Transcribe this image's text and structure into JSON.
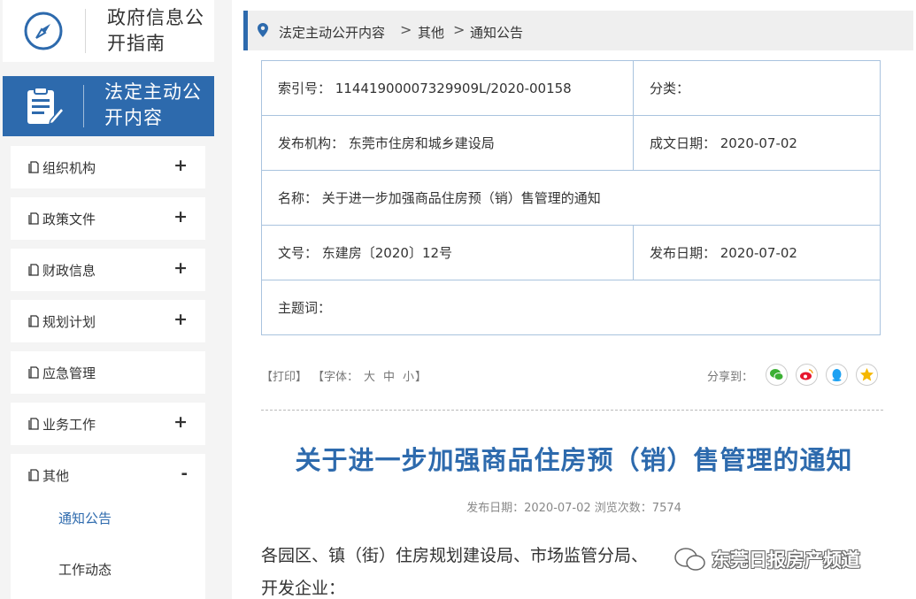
{
  "sidebar": {
    "guide_title": "政府信息公开指南",
    "active_title": "法定主动公开内容",
    "items": [
      {
        "label": "组织机构",
        "toggle": "+"
      },
      {
        "label": "政策文件",
        "toggle": "+"
      },
      {
        "label": "财政信息",
        "toggle": "+"
      },
      {
        "label": "规划计划",
        "toggle": "+"
      },
      {
        "label": "应急管理",
        "toggle": ""
      },
      {
        "label": "业务工作",
        "toggle": "+"
      }
    ],
    "open_item": {
      "label": "其他",
      "toggle": "-",
      "children": [
        "通知公告",
        "工作动态"
      ]
    }
  },
  "breadcrumb": {
    "items": [
      "法定主动公开内容",
      "其他",
      "通知公告"
    ],
    "separator": ">"
  },
  "info": {
    "index_no": "索引号： 11441900007329909L/2020-00158",
    "category": "分类：",
    "publisher": "发布机构： 东莞市住房和城乡建设局",
    "written_date": "成文日期： 2020-07-02",
    "name": "名称： 关于进一步加强商品住房预（销）售管理的通知",
    "doc_no": "文号： 东建房〔2020〕12号",
    "publish_date": "发布日期： 2020-07-02",
    "keywords": "主题词："
  },
  "toolbar": {
    "print": "【打印】",
    "font_prefix": "【字体：",
    "font_large": "大",
    "font_medium": "中",
    "font_small": "小",
    "font_suffix": "】",
    "share_label": "分享到："
  },
  "article": {
    "title": "关于进一步加强商品住房预（销）售管理的通知",
    "meta": "发布日期：2020-07-02  浏览次数：7574",
    "body_line1": "各园区、镇（街）住房规划建设局、市场监管分局、",
    "body_line2": "开发企业："
  },
  "watermark": {
    "text": "东莞日报房产频道"
  },
  "colors": {
    "accent": "#2d6aad",
    "border": "#a9c3de",
    "wechat": "#3cb034",
    "weibo": "#e6162d",
    "qq": "#1da1f2",
    "qzone": "#f5b700"
  }
}
